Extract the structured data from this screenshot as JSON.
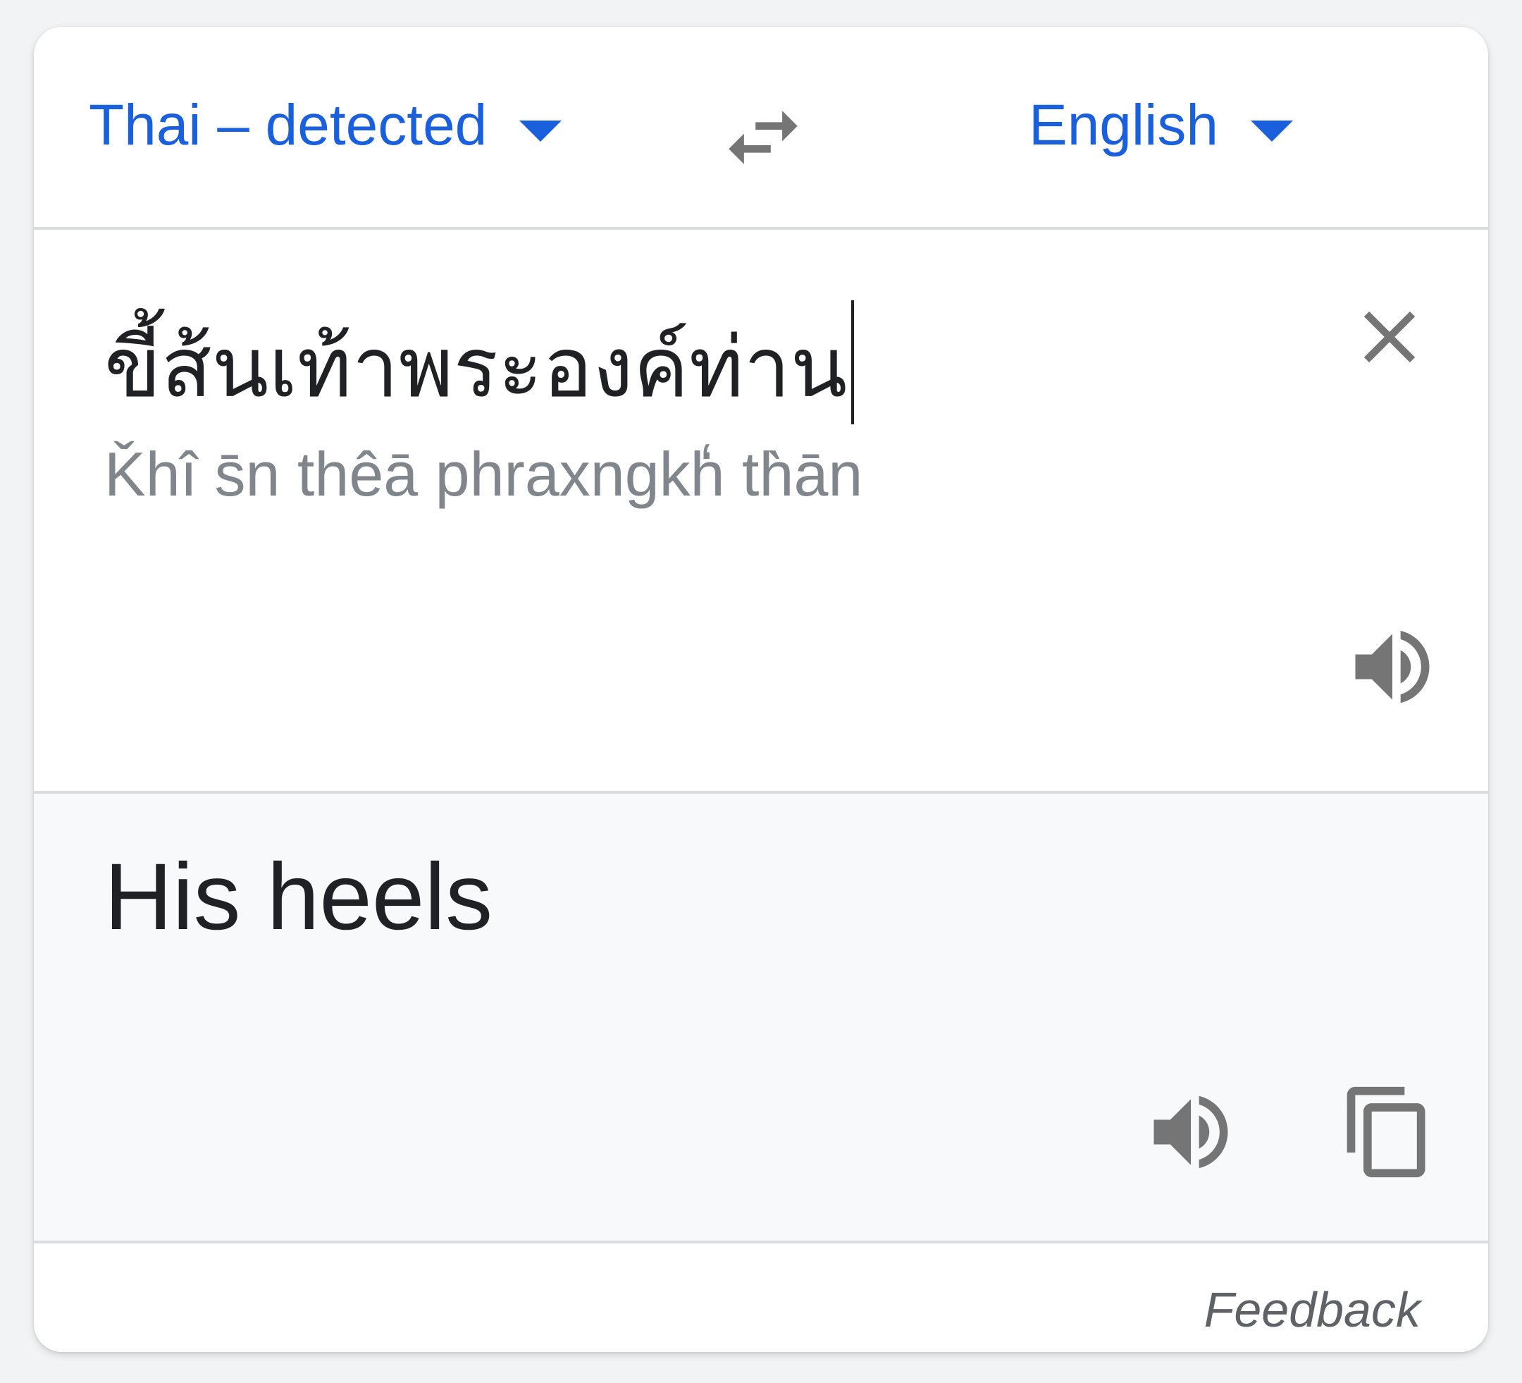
{
  "language_bar": {
    "source_language": "Thai – detected",
    "target_language": "English",
    "swap_icon": "swap-arrows-icon"
  },
  "source": {
    "text": "ขี้ส้นเท้าพระองค์ท่าน",
    "transliteration": "Ǩhî s̄n thêā phraxngkh̒ th̀ān",
    "clear_icon": "close-icon",
    "speaker_icon": "volume-icon"
  },
  "target": {
    "text": "His heels",
    "speaker_icon": "volume-icon",
    "copy_icon": "copy-icon"
  },
  "footer": {
    "feedback_label": "Feedback"
  },
  "colors": {
    "accent": "#1a5fdc",
    "icon_gray": "#757575",
    "divider": "#dadce0",
    "target_bg": "#f8f9fa"
  }
}
